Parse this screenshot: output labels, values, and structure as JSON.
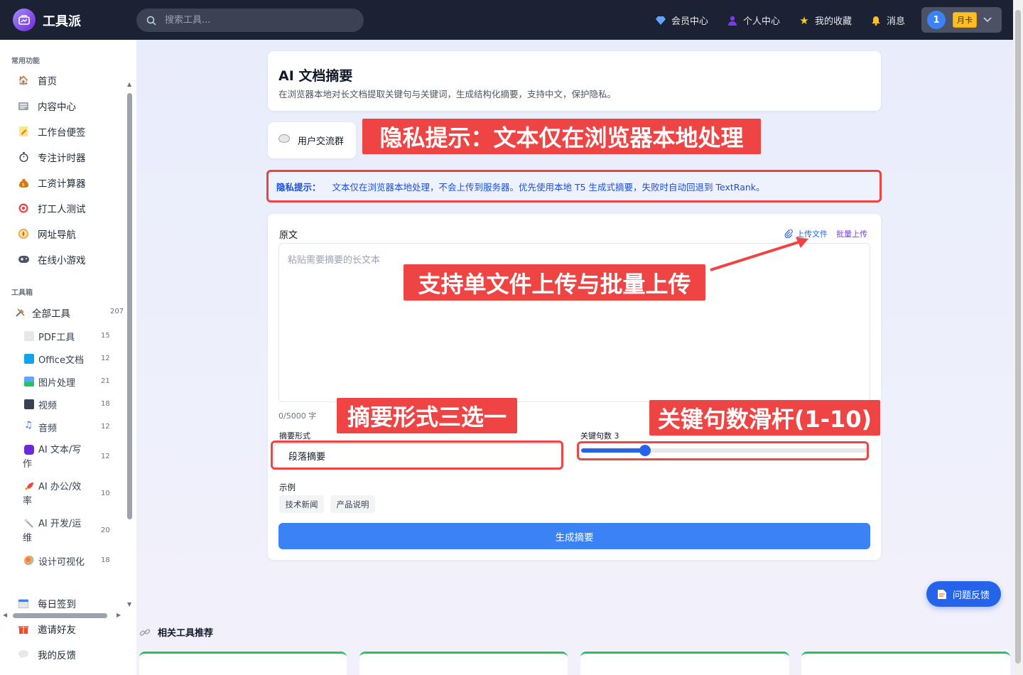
{
  "header": {
    "app_name": "工具派",
    "search_placeholder": "搜索工具...",
    "nav": [
      {
        "label": "会员中心",
        "icon": "diamond-icon"
      },
      {
        "label": "个人中心",
        "icon": "user-icon"
      },
      {
        "label": "我的收藏",
        "icon": "star-icon"
      },
      {
        "label": "消息",
        "icon": "bell-icon"
      }
    ],
    "user": {
      "avatar_text": "1",
      "badge": "月卡"
    }
  },
  "sidebar": {
    "section_common": "常用功能",
    "common": [
      {
        "label": "首页",
        "icon": "home-icon"
      },
      {
        "label": "内容中心",
        "icon": "newspaper-icon"
      },
      {
        "label": "工作台便签",
        "icon": "memo-icon"
      },
      {
        "label": "专注计时器",
        "icon": "timer-icon"
      },
      {
        "label": "工资计算器",
        "icon": "money-bag-icon"
      },
      {
        "label": "打工人测试",
        "icon": "target-icon"
      },
      {
        "label": "网址导航",
        "icon": "compass-icon"
      },
      {
        "label": "在线小游戏",
        "icon": "gamepad-icon"
      }
    ],
    "section_tools": "工具箱",
    "all_tools": {
      "label": "全部工具",
      "count": "207"
    },
    "tools": [
      {
        "label": "PDF工具",
        "count": "15"
      },
      {
        "label": "Office文档",
        "count": "12"
      },
      {
        "label": "图片处理",
        "count": "21"
      },
      {
        "label": "视频",
        "count": "18"
      },
      {
        "label": "音频",
        "count": "12"
      },
      {
        "label": "AI 文本/写",
        "label2": "作",
        "count": "12"
      },
      {
        "label": "AI 办公/效",
        "label2": "率",
        "count": "10"
      },
      {
        "label": "AI 开发/运",
        "label2": "维",
        "count": "20"
      },
      {
        "label": "设计可视化",
        "count": "18"
      }
    ],
    "bottom": [
      {
        "label": "每日签到",
        "icon": "calendar-icon"
      },
      {
        "label": "邀请好友",
        "icon": "gift-icon"
      },
      {
        "label": "我的反馈",
        "icon": "speech-bubble-icon"
      }
    ]
  },
  "main": {
    "title": "AI 文档摘要",
    "description": "在浏览器本地对长文档提取关键句与关键词，生成结构化摘要，支持中文，保护隐私。",
    "group_button": "用户交流群",
    "privacy_label": "隐私提示：",
    "privacy_text": "文本仅在浏览器本地处理，不会上传到服务器。优先使用本地 T5 生成式摘要，失败时自动回退到 TextRank。",
    "source_label": "原文",
    "upload_file": "上传文件",
    "batch_upload": "批量上传",
    "textarea_placeholder": "粘贴需要摘要的长文本",
    "char_counter": "0/5000 字",
    "summary_form_label": "摘要形式",
    "summary_form_value": "段落摘要",
    "key_sentence_label": "关键句数",
    "key_sentence_value": "3",
    "key_sentence_min": 1,
    "key_sentence_max": 10,
    "examples_label": "示例",
    "examples": [
      "技术新闻",
      "产品说明"
    ],
    "generate_button": "生成摘要",
    "feedback_button": "问题反馈",
    "related_title": "相关工具推荐"
  },
  "annotations": {
    "privacy": "隐私提示：文本仅在浏览器本地处理",
    "upload": "支持单文件上传与批量上传",
    "form": "摘要形式三选一",
    "slider": "关键句数滑杆(1-10)"
  },
  "colors": {
    "accent": "#3b82f6",
    "header_bg": "#1b2233",
    "annotation": "#ef4444"
  }
}
